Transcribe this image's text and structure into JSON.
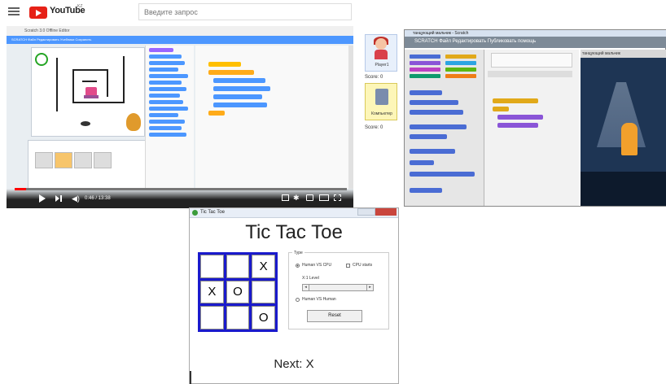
{
  "youtube": {
    "logo_text": "YouTube",
    "country": "KZ",
    "search_placeholder": "Введите запрос"
  },
  "video1": {
    "window_title": "Scratch 3.0 Offline Editor",
    "menubar": "SCRATCH  Файл  Редактировать  Учебники  Сохранить",
    "time": "0:46 / 13:38",
    "progress_fraction": 0.035
  },
  "rightpane": {
    "player_name": "Player1",
    "player_score": "Score: 0",
    "computer_name": "Компьютер",
    "computer_score": "Score: 0",
    "scratch2": {
      "window_title": "танцующий мальчик - Scratch",
      "menubar": "SCRATCH   Файл   Редактировать   Публиковать   помощь",
      "stage_label": "танцующий мальчик"
    }
  },
  "tictactoe": {
    "window_title": "Tic Tac Toe",
    "header": "Tic Tac Toe",
    "board": [
      "",
      "",
      "X",
      "X",
      "O",
      "",
      "",
      "",
      "O"
    ],
    "options_legend": "Type",
    "mode_human_cpu": "Human VS CPU",
    "mode_cpu_starts": "CPU starts",
    "level_label": "X:1 Level",
    "mode_human_human": "Human VS Human",
    "reset_label": "Reset",
    "next_label": "Next: X"
  }
}
